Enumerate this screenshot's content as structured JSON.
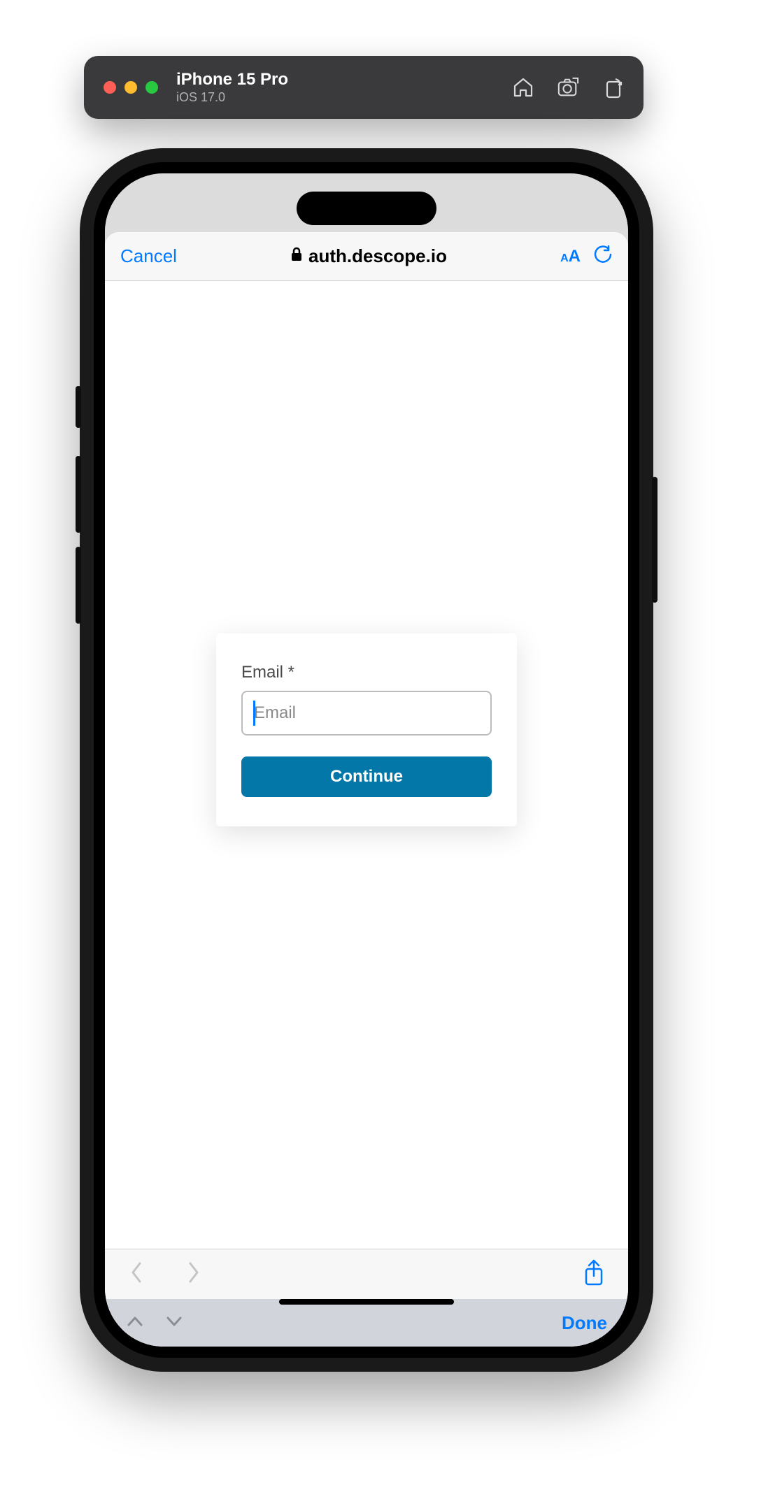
{
  "simulator": {
    "device_name": "iPhone 15 Pro",
    "os_version": "iOS 17.0"
  },
  "safari": {
    "cancel_label": "Cancel",
    "url_host": "auth.descope.io",
    "text_size_label": "AA",
    "done_label": "Done"
  },
  "auth_form": {
    "email_label": "Email *",
    "email_placeholder": "Email",
    "email_value": "",
    "continue_label": "Continue"
  }
}
